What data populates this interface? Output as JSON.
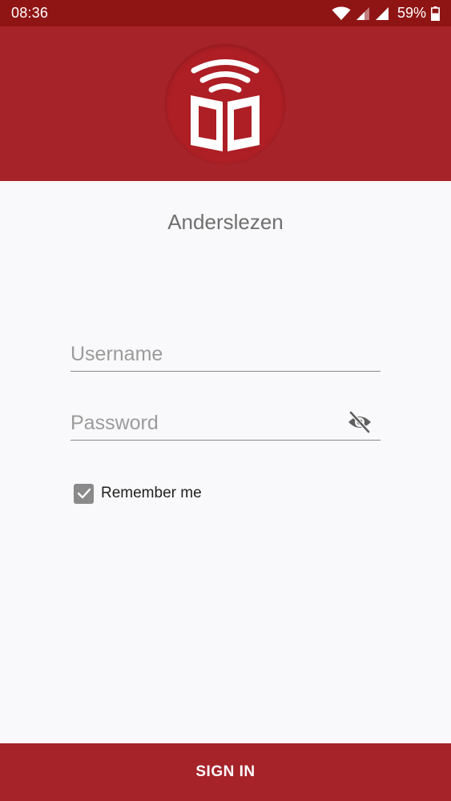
{
  "status_bar": {
    "time": "08:36",
    "battery": "59%",
    "icons": [
      "wifi-icon",
      "signal-icon",
      "signal-icon",
      "battery-icon"
    ]
  },
  "header": {
    "logo_icon": "book-broadcast-icon",
    "background_color": "#a6232a"
  },
  "app": {
    "title": "Anderslezen"
  },
  "login_form": {
    "username_placeholder": "Username",
    "username_value": "",
    "password_placeholder": "Password",
    "password_value": "",
    "password_toggle_icon": "eye-off-icon",
    "remember_me_label": "Remember me",
    "remember_me_checked": true
  },
  "actions": {
    "sign_in_label": "SIGN IN"
  }
}
